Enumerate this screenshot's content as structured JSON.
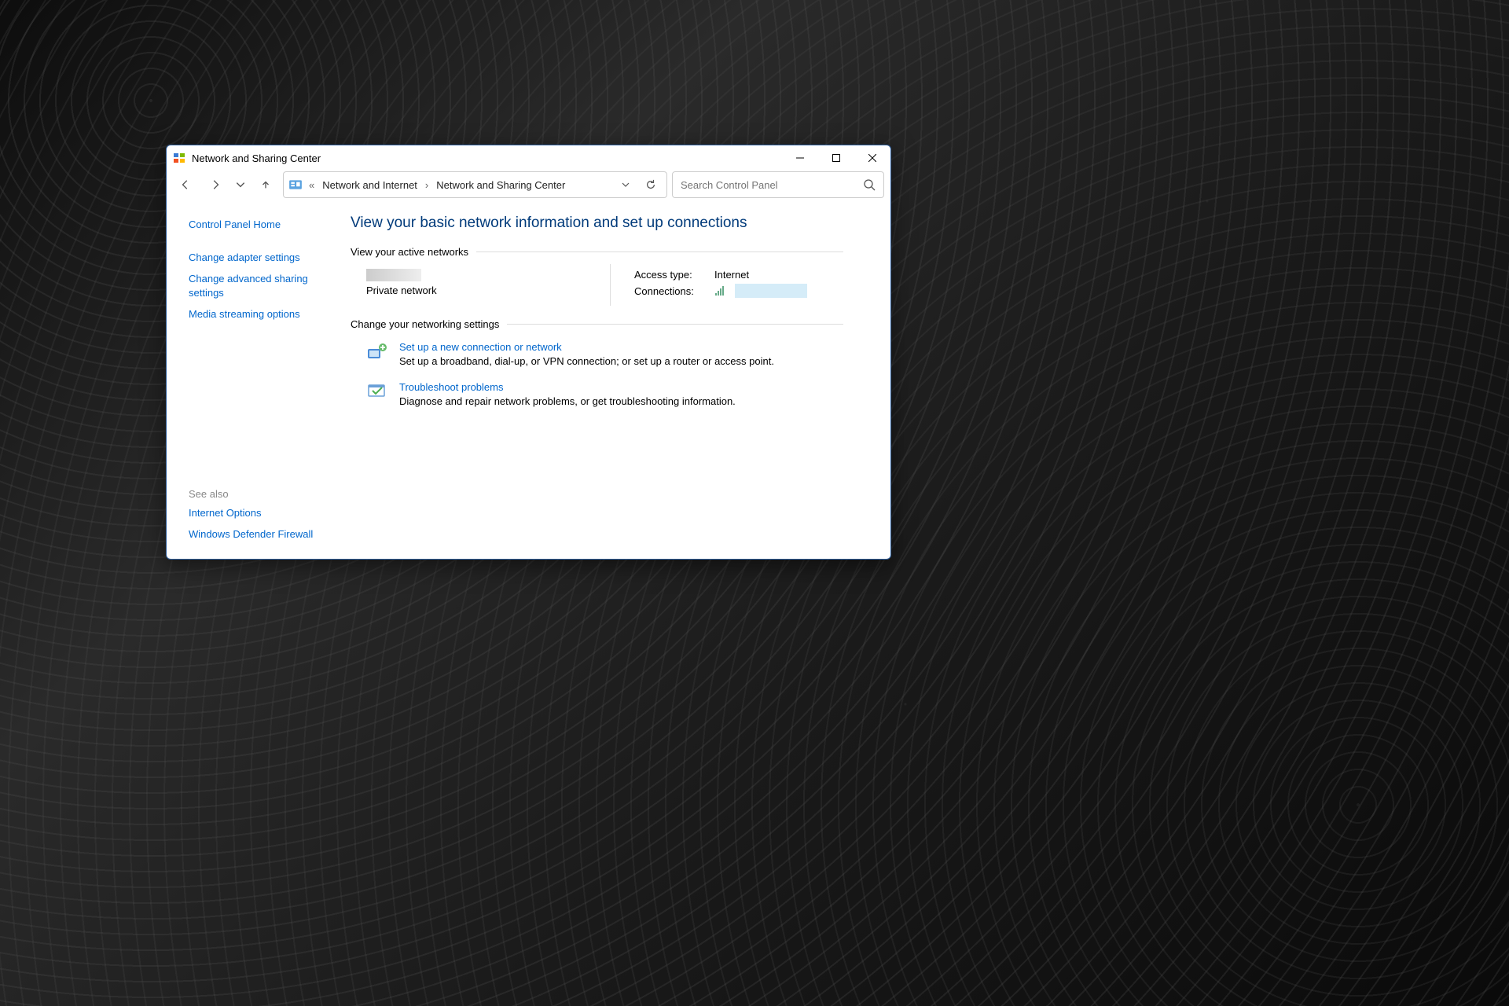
{
  "window": {
    "title": "Network and Sharing Center"
  },
  "breadcrumb": {
    "ellipsis": "«",
    "items": [
      "Network and Internet",
      "Network and Sharing Center"
    ]
  },
  "search": {
    "placeholder": "Search Control Panel"
  },
  "sidebar": {
    "home": "Control Panel Home",
    "links": [
      "Change adapter settings",
      "Change advanced sharing settings",
      "Media streaming options"
    ],
    "seealso_header": "See also",
    "seealso": [
      "Internet Options",
      "Windows Defender Firewall"
    ]
  },
  "main": {
    "heading": "View your basic network information and set up connections",
    "active_networks_label": "View your active networks",
    "network": {
      "type": "Private network",
      "access_type_label": "Access type:",
      "access_type_value": "Internet",
      "connections_label": "Connections:"
    },
    "change_settings_label": "Change your networking settings",
    "tasks": [
      {
        "title": "Set up a new connection or network",
        "desc": "Set up a broadband, dial-up, or VPN connection; or set up a router or access point."
      },
      {
        "title": "Troubleshoot problems",
        "desc": "Diagnose and repair network problems, or get troubleshooting information."
      }
    ]
  }
}
